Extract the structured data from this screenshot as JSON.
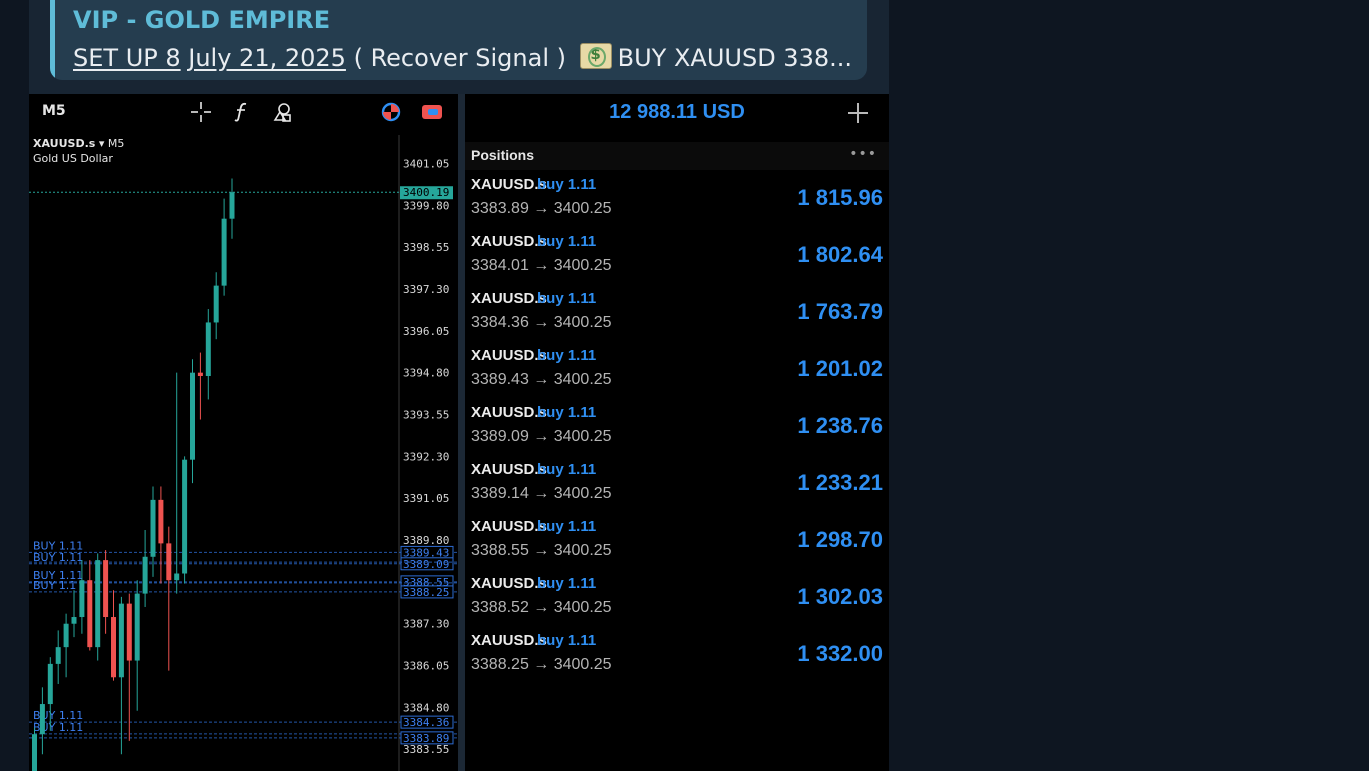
{
  "reply": {
    "title": "VIP - GOLD EMPIRE",
    "part1": "SET UP 8",
    "part2": "July 21, 2025",
    "part3": "( Recover Signal )",
    "emoji_name": "money-bag-emoji",
    "part4": "BUY XAUUSD 338..."
  },
  "chart": {
    "timeframe": "M5",
    "symbol": "XAUUSD.s",
    "dropdown_glyph": "▾",
    "symbol_timeframe": "M5",
    "description": "Gold US Dollar",
    "icons": [
      "crosshair-icon",
      "indicator-f-icon",
      "shapes-icon",
      "trade-toggle-icon",
      "toggle-icon"
    ]
  },
  "chart_data": {
    "type": "candlestick",
    "ylim": [
      3382.9,
      3401.9
    ],
    "y_ticks": [
      "3401.05",
      "3399.80",
      "3398.55",
      "3397.30",
      "3396.05",
      "3394.80",
      "3393.55",
      "3392.30",
      "3391.05",
      "3389.80",
      "3388.55",
      "3387.30",
      "3386.05",
      "3384.80",
      "3383.55"
    ],
    "y_tick_values": [
      3401.05,
      3399.8,
      3398.55,
      3397.3,
      3396.05,
      3394.8,
      3393.55,
      3392.3,
      3391.05,
      3389.8,
      3388.55,
      3387.3,
      3386.05,
      3384.8,
      3383.55
    ],
    "current_price": {
      "label": "3400.19",
      "value": 3400.19
    },
    "position_lines": [
      {
        "price": 3389.43,
        "label": "3389.43",
        "tag": "BUY 1.11"
      },
      {
        "price": 3389.09,
        "label": "3389.09",
        "tag": "BUY 1.11"
      },
      {
        "price": 3389.14,
        "label": "",
        "tag": ""
      },
      {
        "price": 3388.55,
        "label": "3388.55",
        "tag": "BUY 1.11"
      },
      {
        "price": 3388.52,
        "label": "",
        "tag": ""
      },
      {
        "price": 3388.25,
        "label": "3388.25",
        "tag": "BUY 1.1"
      },
      {
        "price": 3384.36,
        "label": "3384.36",
        "tag": "BUY 1.11"
      },
      {
        "price": 3384.01,
        "label": "",
        "tag": "BUY 1.11"
      },
      {
        "price": 3383.89,
        "label": "3383.89",
        "tag": ""
      }
    ],
    "candles": [
      {
        "o": 3382.8,
        "h": 3384.2,
        "l": 3381.0,
        "c": 3384.0
      },
      {
        "o": 3384.0,
        "h": 3385.4,
        "l": 3383.4,
        "c": 3384.9
      },
      {
        "o": 3384.9,
        "h": 3386.3,
        "l": 3384.1,
        "c": 3386.1
      },
      {
        "o": 3386.1,
        "h": 3387.1,
        "l": 3385.5,
        "c": 3386.6
      },
      {
        "o": 3386.6,
        "h": 3387.6,
        "l": 3385.7,
        "c": 3387.3
      },
      {
        "o": 3387.3,
        "h": 3388.3,
        "l": 3386.9,
        "c": 3387.5
      },
      {
        "o": 3387.5,
        "h": 3389.2,
        "l": 3387.0,
        "c": 3388.6
      },
      {
        "o": 3388.6,
        "h": 3389.2,
        "l": 3386.5,
        "c": 3386.6
      },
      {
        "o": 3386.6,
        "h": 3389.4,
        "l": 3386.2,
        "c": 3389.2
      },
      {
        "o": 3389.2,
        "h": 3389.5,
        "l": 3387.0,
        "c": 3387.5
      },
      {
        "o": 3387.5,
        "h": 3388.3,
        "l": 3385.6,
        "c": 3385.7
      },
      {
        "o": 3385.7,
        "h": 3388.1,
        "l": 3383.4,
        "c": 3387.9
      },
      {
        "o": 3387.9,
        "h": 3388.2,
        "l": 3383.8,
        "c": 3386.2
      },
      {
        "o": 3386.2,
        "h": 3388.6,
        "l": 3384.7,
        "c": 3388.2
      },
      {
        "o": 3388.2,
        "h": 3390.1,
        "l": 3387.8,
        "c": 3389.3
      },
      {
        "o": 3389.3,
        "h": 3391.4,
        "l": 3388.7,
        "c": 3391.0
      },
      {
        "o": 3391.0,
        "h": 3391.4,
        "l": 3388.5,
        "c": 3389.7
      },
      {
        "o": 3389.7,
        "h": 3390.2,
        "l": 3385.9,
        "c": 3388.6
      },
      {
        "o": 3388.6,
        "h": 3394.8,
        "l": 3388.2,
        "c": 3388.8
      },
      {
        "o": 3388.8,
        "h": 3392.3,
        "l": 3388.5,
        "c": 3392.2
      },
      {
        "o": 3392.2,
        "h": 3395.2,
        "l": 3391.5,
        "c": 3394.8
      },
      {
        "o": 3394.8,
        "h": 3395.4,
        "l": 3393.4,
        "c": 3394.7
      },
      {
        "o": 3394.7,
        "h": 3396.7,
        "l": 3394.0,
        "c": 3396.3
      },
      {
        "o": 3396.3,
        "h": 3397.8,
        "l": 3395.8,
        "c": 3397.4
      },
      {
        "o": 3397.4,
        "h": 3400.0,
        "l": 3397.1,
        "c": 3399.4
      },
      {
        "o": 3399.4,
        "h": 3400.6,
        "l": 3398.8,
        "c": 3400.19
      }
    ]
  },
  "account": {
    "balance": "12 988.11 USD"
  },
  "positions_title": "Positions",
  "more_glyph": "•••",
  "positions": [
    {
      "symbol": "XAUUSD.s",
      "side": "buy 1.11",
      "prices": "3383.89 → 3400.25",
      "profit": "1 815.96"
    },
    {
      "symbol": "XAUUSD.s",
      "side": "buy 1.11",
      "prices": "3384.01 → 3400.25",
      "profit": "1 802.64"
    },
    {
      "symbol": "XAUUSD.s",
      "side": "buy 1.11",
      "prices": "3384.36 → 3400.25",
      "profit": "1 763.79"
    },
    {
      "symbol": "XAUUSD.s",
      "side": "buy 1.11",
      "prices": "3389.43 → 3400.25",
      "profit": "1 201.02"
    },
    {
      "symbol": "XAUUSD.s",
      "side": "buy 1.11",
      "prices": "3389.09 → 3400.25",
      "profit": "1 238.76"
    },
    {
      "symbol": "XAUUSD.s",
      "side": "buy 1.11",
      "prices": "3389.14 → 3400.25",
      "profit": "1 233.21"
    },
    {
      "symbol": "XAUUSD.s",
      "side": "buy 1.11",
      "prices": "3388.55 → 3400.25",
      "profit": "1 298.70"
    },
    {
      "symbol": "XAUUSD.s",
      "side": "buy 1.11",
      "prices": "3388.52 → 3400.25",
      "profit": "1 302.03"
    },
    {
      "symbol": "XAUUSD.s",
      "side": "buy 1.11",
      "prices": "3388.25 → 3400.25",
      "profit": "1 332.00"
    }
  ],
  "colors": {
    "bull": "#26a69a",
    "bear": "#ef5350",
    "position_line": "#2d6bd1",
    "price_line": "#26a69a",
    "accent_blue": "#2f8ff2",
    "reply_accent": "#5fbcd8"
  }
}
